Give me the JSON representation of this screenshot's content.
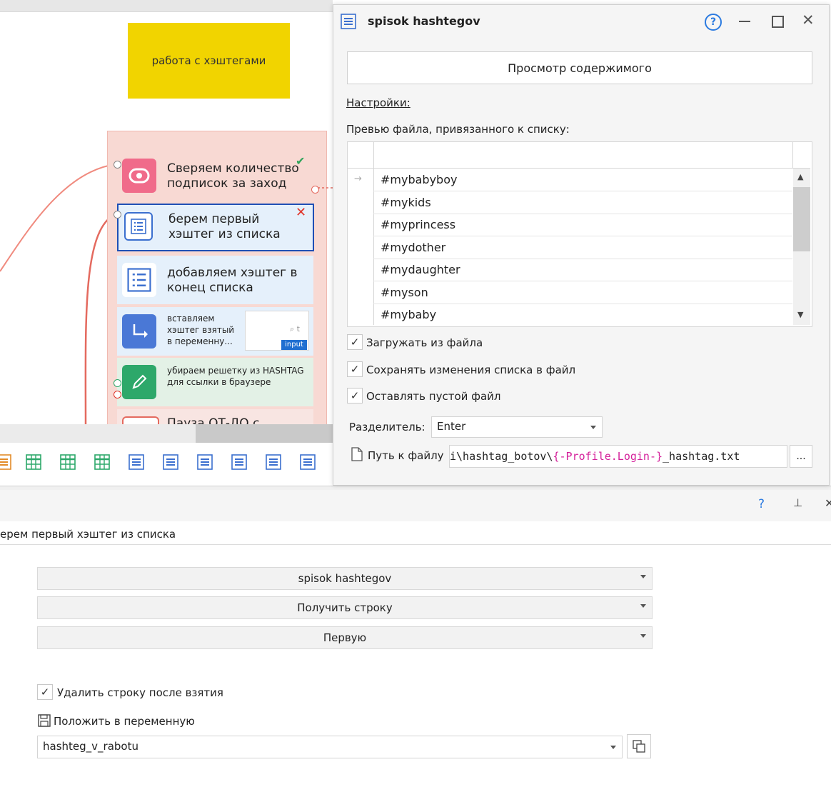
{
  "canvas": {
    "note_text": "работа с хэштегами",
    "blocks": [
      {
        "label": "Сверяем количество подписок за заход",
        "icon": "toggle-icon",
        "color": "#f06b8a"
      },
      {
        "label": "берем первый хэштег из списка",
        "icon": "list-icon",
        "color": "#ffffff"
      },
      {
        "label": "добавляем хэштег в конец списка",
        "icon": "list-icon",
        "color": "#ffffff"
      },
      {
        "label": "вставляем хэштег взятый в переменну...",
        "icon": "redirect-icon",
        "color": "#4a78d6",
        "badge": "input"
      },
      {
        "label": "убираем решетку из HASHTAG для ссылки в браузере",
        "icon": "pencil-icon",
        "color": "#2da86a"
      },
      {
        "label": "Пауза ОТ-ДО с",
        "icon": "pause-icon",
        "color": "#ffffff"
      }
    ],
    "toolbar_icons": [
      "list-icon-orange",
      "table-icon",
      "table-icon",
      "table-icon",
      "list-icon",
      "list-icon",
      "list-icon",
      "list-icon",
      "list-icon",
      "list-icon"
    ]
  },
  "dialog": {
    "title": "spisok hashtegov",
    "view_contents_button": "Просмотр содержимого",
    "settings_link": "Настройки:",
    "preview_label": "Превью файла, привязанного к списку:",
    "list_items": [
      "#mybabyboy",
      "#mykids",
      "#myprincess",
      "#mydother",
      "#mydaughter",
      "#myson",
      "#mybaby"
    ],
    "load_from_file": "Загружать из файла",
    "save_changes": "Сохранять изменения списка в файл",
    "keep_empty": "Оставлять пустой файл",
    "separator_label": "Разделитель:",
    "separator_value": "Enter",
    "path_label": "Путь к файлу",
    "path_value_prefix": "i\\hashtag_botov\\",
    "path_value_var": "{-Profile.Login-}",
    "path_value_suffix": "_hashtag.txt",
    "browse_button": "..."
  },
  "properties": {
    "help_icon": "?",
    "block_name": "ерем первый хэштег из списка",
    "list_select": "spisok hashtegov",
    "action_select": "Получить строку",
    "which_select": "Первую",
    "delete_after_take": "Удалить строку после взятия",
    "save_to_var_label": "Положить в переменную",
    "variable_value": "hashteg_v_rabotu"
  },
  "colors": {
    "note": "#f1d400",
    "group_bg": "#f8d9d3",
    "accent_blue": "#1f6fd1"
  }
}
